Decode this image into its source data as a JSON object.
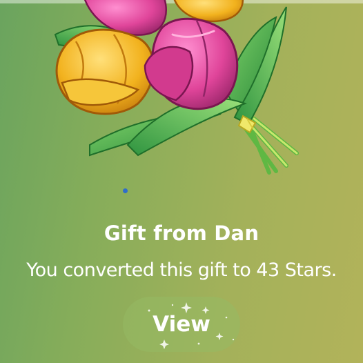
{
  "gift": {
    "title": "Gift from Dan",
    "message": "You converted this gift to 43 Stars.",
    "image": "tulip-bouquet-icon",
    "button_label": "View"
  },
  "colors": {
    "background_start": "#6aa45e",
    "background_end": "#b2b35a",
    "tulip_pink": "#e0459a",
    "tulip_yellow": "#f2b21e",
    "leaf_green": "#3a9a3f",
    "indicator_dot": "#2f6ec9"
  }
}
